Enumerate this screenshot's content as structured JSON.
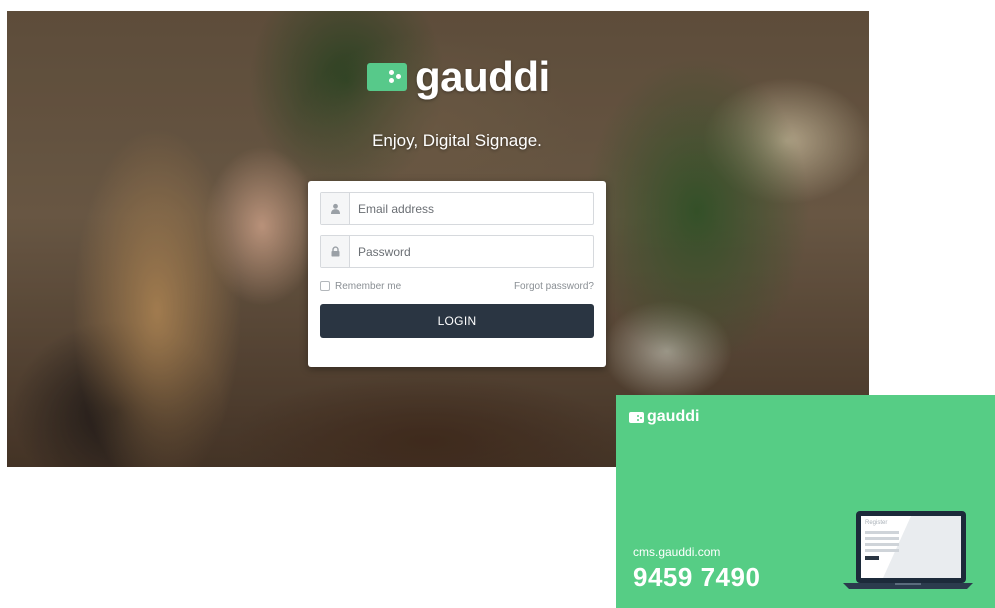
{
  "hero": {
    "brand_name": "gauddi",
    "tagline": "Enjoy, Digital Signage."
  },
  "login": {
    "email_placeholder": "Email address",
    "password_placeholder": "Password",
    "remember_label": "Remember me",
    "forgot_label": "Forgot password?",
    "login_button": "LOGIN"
  },
  "promo": {
    "brand_name": "gauddi",
    "url": "cms.gauddi.com",
    "phone": "9459 7490",
    "screen_heading": "Register"
  },
  "icons": {
    "email": "user-icon",
    "password": "lock-icon"
  },
  "colors": {
    "brand_green": "#56cd85",
    "button_dark": "#2a3542"
  }
}
